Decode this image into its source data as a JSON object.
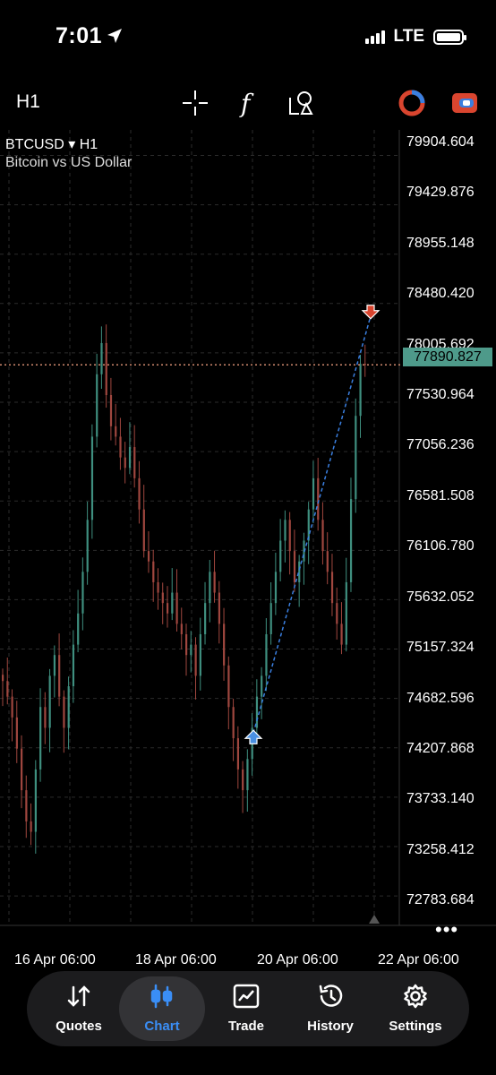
{
  "status": {
    "time": "7:01",
    "network": "LTE"
  },
  "toolbar": {
    "timeframe": "H1",
    "icons": [
      "crosshair-icon",
      "function-icon",
      "objects-icon",
      "account-icon",
      "toggle-icon"
    ]
  },
  "symbol": {
    "name": "BTCUSD",
    "timeframe": "H1",
    "description": "Bitcoin vs US Dollar"
  },
  "price_scale": [
    "79904.604",
    "79429.876",
    "78955.148",
    "78480.420",
    "78005.692",
    "77530.964",
    "77056.236",
    "76581.508",
    "76106.780",
    "75632.052",
    "75157.324",
    "74682.596",
    "74207.868",
    "73733.140",
    "73258.412",
    "72783.684"
  ],
  "current_price": "77890.827",
  "date_labels": [
    "16 Apr 06:00",
    "18 Apr 06:00",
    "20 Apr 06:00",
    "22 Apr 06:00"
  ],
  "more": "•••",
  "colors": {
    "bull": "#3f8f7f",
    "bear": "#a0473f",
    "price_line": "#d08a6e",
    "trade_line": "#3a7fe0",
    "accent": "#3a8ef6"
  },
  "trade": {
    "buy_price": 74350,
    "sell_price": 78360
  },
  "chart_data": {
    "type": "candlestick",
    "symbol": "BTCUSD",
    "timeframe": "H1",
    "ylim": [
      72500,
      80150
    ],
    "x_ticks": [
      "16 Apr 06:00",
      "18 Apr 06:00",
      "20 Apr 06:00",
      "22 Apr 06:00"
    ],
    "close_path": [
      74850,
      74700,
      74500,
      74200,
      73800,
      73500,
      73400,
      74000,
      74600,
      74400,
      74900,
      75100,
      74700,
      74400,
      74800,
      75200,
      75500,
      75900,
      76400,
      77200,
      77800,
      78100,
      77600,
      77300,
      77200,
      77000,
      76900,
      77100,
      76800,
      76500,
      76100,
      76000,
      75800,
      75700,
      75600,
      75500,
      75700,
      75400,
      75300,
      75100,
      75200,
      74900,
      75300,
      75600,
      75900,
      75700,
      75400,
      75000,
      74600,
      74300,
      74000,
      73800,
      74100,
      74400,
      74700,
      74900,
      75300,
      75600,
      75900,
      76200,
      76400,
      76100,
      75800,
      76000,
      76200,
      76500,
      76800,
      76400,
      76100,
      75900,
      75600,
      75400,
      75200,
      75800,
      76600,
      77400,
      77900,
      77890
    ]
  },
  "tabs": [
    {
      "label": "Quotes",
      "icon": "quotes-icon"
    },
    {
      "label": "Chart",
      "icon": "chart-icon"
    },
    {
      "label": "Trade",
      "icon": "trade-icon"
    },
    {
      "label": "History",
      "icon": "history-icon"
    },
    {
      "label": "Settings",
      "icon": "settings-icon"
    }
  ]
}
